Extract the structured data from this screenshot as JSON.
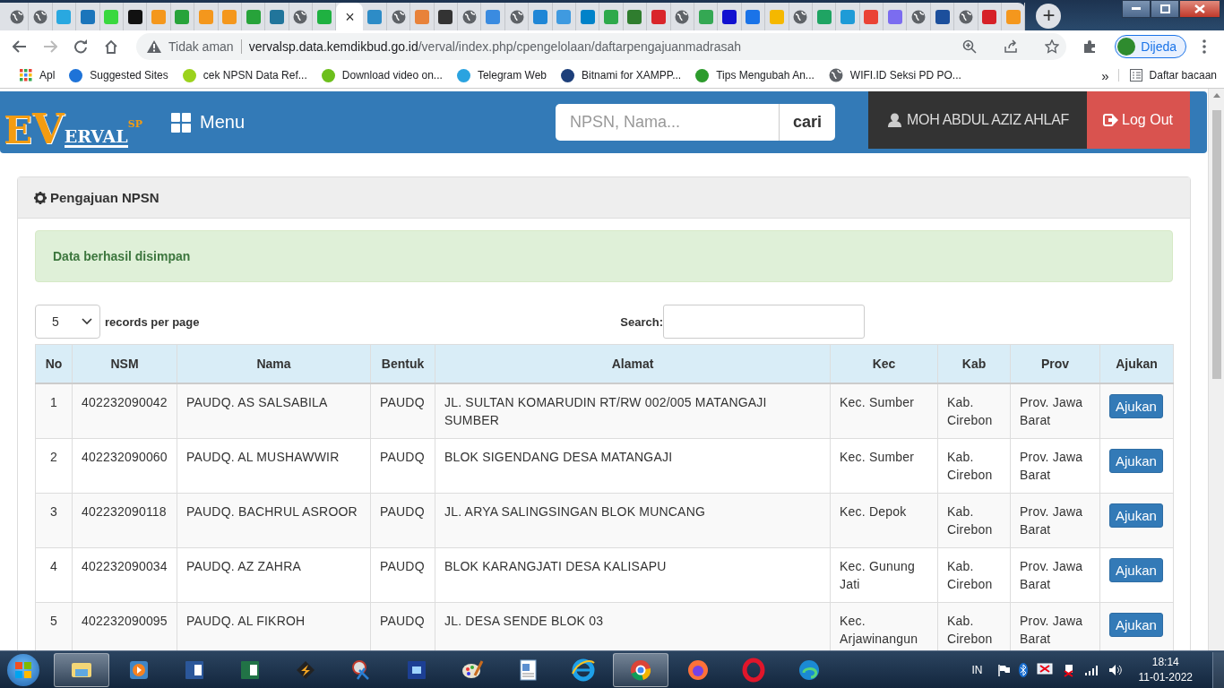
{
  "browser": {
    "tabs": [
      {
        "kind": "globe",
        "selected": false
      },
      {
        "kind": "globe",
        "selected": false
      },
      {
        "kind": "site",
        "color": "#29a8e0",
        "selected": false
      },
      {
        "kind": "site",
        "color": "#1b75bb",
        "selected": false
      },
      {
        "kind": "site",
        "color": "#39d83f",
        "selected": false
      },
      {
        "kind": "site",
        "color": "#111111",
        "selected": false
      },
      {
        "kind": "site",
        "color": "#f4971d",
        "selected": false
      },
      {
        "kind": "site",
        "color": "#27a33a",
        "selected": false
      },
      {
        "kind": "site",
        "color": "#f4971d",
        "selected": false
      },
      {
        "kind": "site",
        "color": "#f4971d",
        "selected": false
      },
      {
        "kind": "site",
        "color": "#27a33a",
        "selected": false
      },
      {
        "kind": "site",
        "color": "#21759b",
        "selected": false
      },
      {
        "kind": "globe",
        "selected": false
      },
      {
        "kind": "site",
        "color": "#1fb141",
        "selected": false
      },
      {
        "kind": "close",
        "selected": true,
        "close": "×"
      },
      {
        "kind": "site",
        "color": "#2d8cc7",
        "selected": false
      },
      {
        "kind": "globe",
        "selected": false
      },
      {
        "kind": "site",
        "color": "#e8823a",
        "selected": false
      },
      {
        "kind": "site",
        "color": "#333333",
        "selected": false
      },
      {
        "kind": "globe",
        "selected": false
      },
      {
        "kind": "site",
        "color": "#3a8be0",
        "selected": false
      },
      {
        "kind": "globe",
        "selected": false
      },
      {
        "kind": "site",
        "color": "#1f86d6",
        "selected": false
      },
      {
        "kind": "site",
        "color": "#3f9ae0",
        "selected": false
      },
      {
        "kind": "site",
        "color": "#0082c9",
        "selected": false
      },
      {
        "kind": "site",
        "color": "#2ea94b",
        "selected": false
      },
      {
        "kind": "site",
        "color": "#2f7d2e",
        "selected": false
      },
      {
        "kind": "site",
        "color": "#d9252a",
        "selected": false
      },
      {
        "kind": "globe",
        "selected": false
      },
      {
        "kind": "site",
        "color": "#34a853",
        "selected": false
      },
      {
        "kind": "site",
        "color": "#1010d0",
        "selected": false
      },
      {
        "kind": "site",
        "color": "#1a73e8",
        "selected": false
      },
      {
        "kind": "site",
        "color": "#f5b800",
        "selected": false
      },
      {
        "kind": "globe",
        "selected": false
      },
      {
        "kind": "site",
        "color": "#1fa463",
        "selected": false
      },
      {
        "kind": "site",
        "color": "#1e9bd7",
        "selected": false
      },
      {
        "kind": "site",
        "color": "#ea4335",
        "selected": false
      },
      {
        "kind": "site",
        "color": "#7b6cf0",
        "selected": false
      },
      {
        "kind": "globe",
        "selected": false
      },
      {
        "kind": "site",
        "color": "#1c4f9c",
        "selected": false
      },
      {
        "kind": "globe",
        "selected": false
      },
      {
        "kind": "site",
        "color": "#d62027",
        "selected": false
      },
      {
        "kind": "site",
        "color": "#f4971d",
        "selected": false
      }
    ],
    "new_tab": "+",
    "security": "Tidak aman",
    "url_host": "vervalsp.data.kemdikbud.go.id",
    "url_path": "/verval/index.php/cpengelolaan/daftarpengajuanmadrasah",
    "profile": "Dijeda",
    "bookmarks": [
      {
        "kind": "apps",
        "label": "Apl"
      },
      {
        "kind": "site",
        "color": "#1e73d8",
        "label": "Suggested Sites"
      },
      {
        "kind": "site",
        "color": "#9bd21c",
        "label": "cek NPSN Data Ref..."
      },
      {
        "kind": "site",
        "color": "#6cbf1c",
        "label": "Download video on..."
      },
      {
        "kind": "site",
        "color": "#2aa3e0",
        "label": "Telegram Web"
      },
      {
        "kind": "site",
        "color": "#1d3f7a",
        "label": "Bitnami for XAMPP..."
      },
      {
        "kind": "site",
        "color": "#2c9b2c",
        "label": "Tips Mengubah An..."
      },
      {
        "kind": "globe",
        "label": "WIFI.ID Seksi PD PO..."
      }
    ],
    "more": "»",
    "reading_list": "Daftar bacaan"
  },
  "header": {
    "logo": [
      "E",
      "V",
      "ERVAL",
      "SP"
    ],
    "menu": "Menu",
    "search_placeholder": "NPSN, Nama...",
    "search_button": "cari",
    "user": "MOH ABDUL AZIZ AHLAF",
    "logout": "Log Out"
  },
  "panel": {
    "title": "Pengajuan NPSN",
    "alert": "Data berhasil disimpan",
    "page_size": "5",
    "page_size_label": "records per page",
    "search_label": "Search:",
    "table": {
      "columns": [
        "No",
        "NSM",
        "Nama",
        "Bentuk",
        "Alamat",
        "Kec",
        "Kab",
        "Prov",
        "Ajukan"
      ],
      "rows": [
        {
          "cells": [
            "1",
            "402232090042",
            "PAUDQ. AS SALSABILA",
            "PAUDQ",
            "JL. SULTAN KOMARUDIN RT/RW 002/005 MATANGAJI SUMBER",
            "Kec. Sumber",
            "Kab. Cirebon",
            "Prov. Jawa Barat"
          ],
          "action": "Ajukan"
        },
        {
          "cells": [
            "2",
            "402232090060",
            "PAUDQ. AL MUSHAWWIR",
            "PAUDQ",
            "BLOK SIGENDANG DESA MATANGAJI",
            "Kec. Sumber",
            "Kab. Cirebon",
            "Prov. Jawa Barat"
          ],
          "action": "Ajukan"
        },
        {
          "cells": [
            "3",
            "402232090118",
            "PAUDQ. BACHRUL ASROOR",
            "PAUDQ",
            "JL. ARYA SALINGSINGAN BLOK MUNCANG",
            "Kec. Depok",
            "Kab. Cirebon",
            "Prov. Jawa Barat"
          ],
          "action": "Ajukan"
        },
        {
          "cells": [
            "4",
            "402232090034",
            "PAUDQ. AZ ZAHRA",
            "PAUDQ",
            "BLOK KARANGJATI DESA KALISAPU",
            "Kec. Gunung Jati",
            "Kab. Cirebon",
            "Prov. Jawa Barat"
          ],
          "action": "Ajukan"
        },
        {
          "cells": [
            "5",
            "402232090095",
            "PAUDQ. AL FIKROH",
            "PAUDQ",
            "JL. DESA SENDE BLOK 03",
            "Kec. Arjawinangun",
            "Kab. Cirebon",
            "Prov. Jawa Barat"
          ],
          "action": "Ajukan"
        }
      ]
    }
  },
  "taskbar": {
    "apps": [
      {
        "kind": "explorer",
        "selected": true
      },
      {
        "kind": "media",
        "selected": false
      },
      {
        "kind": "word",
        "selected": false
      },
      {
        "kind": "excel",
        "selected": false
      },
      {
        "kind": "winamp",
        "selected": false
      },
      {
        "kind": "snip",
        "selected": false
      },
      {
        "kind": "photoshop",
        "selected": false
      },
      {
        "kind": "paint",
        "selected": false
      },
      {
        "kind": "wordpad",
        "selected": false
      },
      {
        "kind": "ie",
        "selected": false
      },
      {
        "kind": "chrome",
        "selected": true
      },
      {
        "kind": "firefox",
        "selected": false
      },
      {
        "kind": "opera",
        "selected": false
      },
      {
        "kind": "edge",
        "selected": false
      }
    ],
    "language": "IN",
    "time": "18:14",
    "date": "11-01-2022"
  }
}
